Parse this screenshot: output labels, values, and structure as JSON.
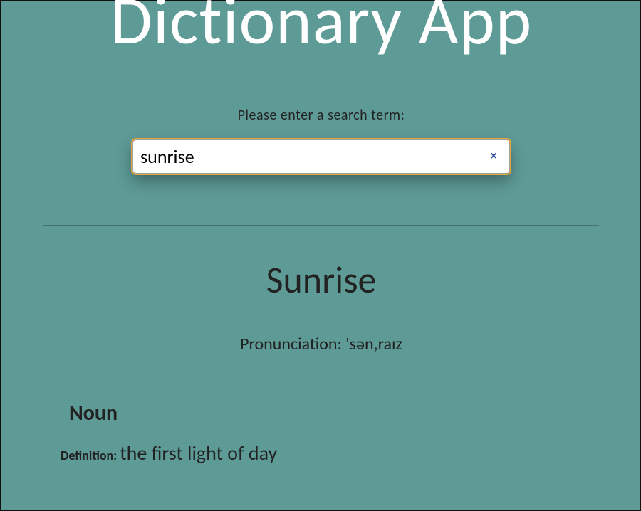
{
  "app": {
    "title": "Dictionary App"
  },
  "search": {
    "label": "Please enter a search term:",
    "value": "sunrise",
    "clear_icon": "×"
  },
  "result": {
    "word": "Sunrise",
    "pronunciation_label": "Pronunciation: ",
    "pronunciation": "'sən,raɪz",
    "part_of_speech": "Noun",
    "definition_label": "Definition: ",
    "definition": "the first light of day"
  }
}
